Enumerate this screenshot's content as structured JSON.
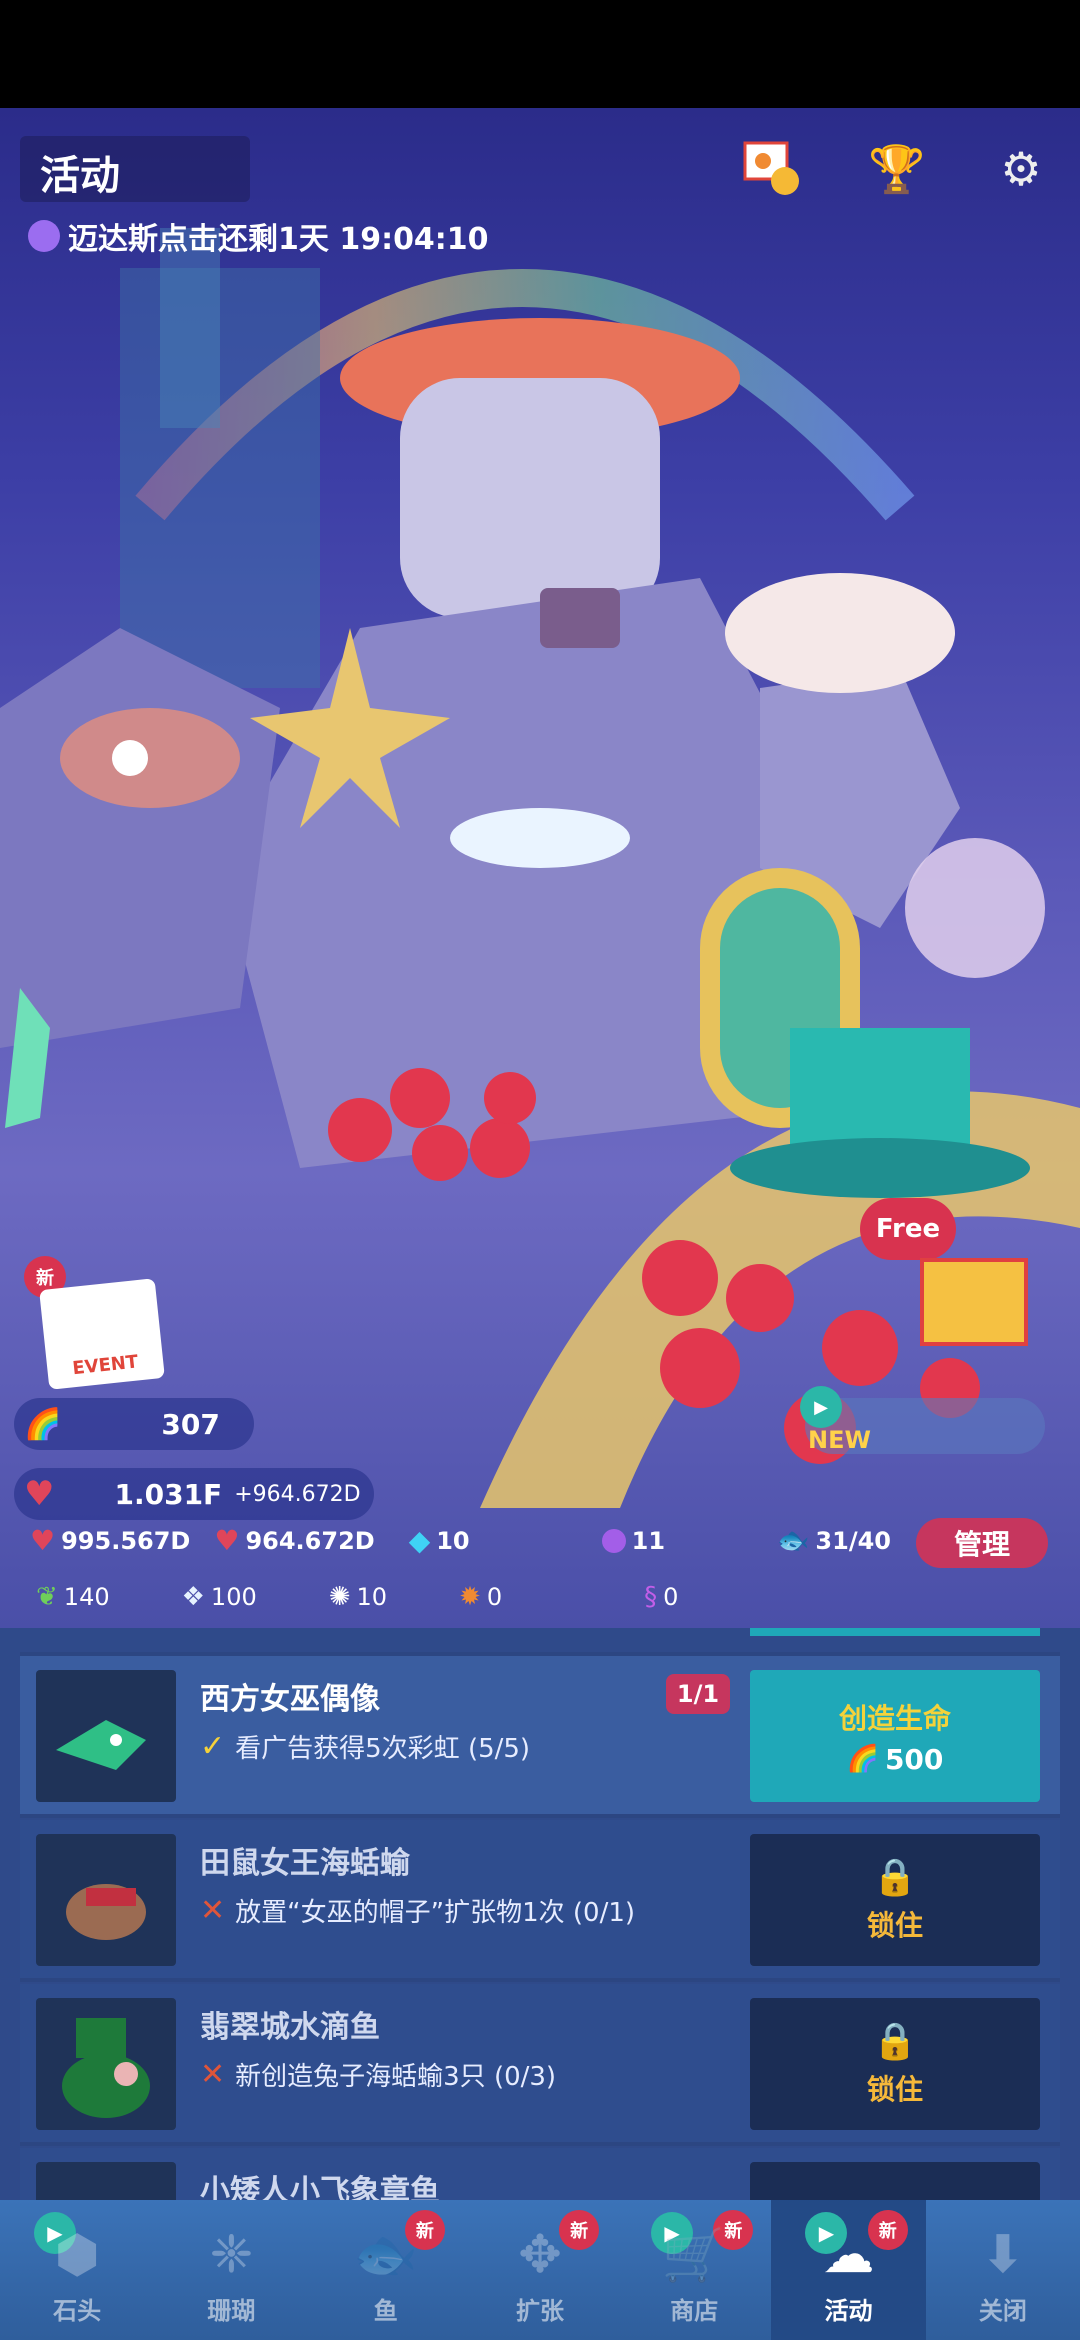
{
  "header": {
    "title": "活动",
    "countdown": "迈达斯点击还剩1天 19:04:10",
    "icons": [
      "photo-medal-icon",
      "trophy-icon",
      "gear-icon"
    ]
  },
  "scene": {
    "event_badge": "新",
    "event_label": "EVENT",
    "free_label": "Free",
    "new_label": "NEW"
  },
  "stats": {
    "rainbow_count": "307",
    "love_total": "1.031F",
    "love_rate": "+964.672D",
    "tap_value": "995.567D",
    "idle_value": "964.672D",
    "gems": "10",
    "pearls": "11",
    "fish_capacity": "31/40",
    "manage_label": "管理",
    "resources": [
      {
        "icon": "seaweed-icon",
        "value": "140"
      },
      {
        "icon": "crystal-icon",
        "value": "100"
      },
      {
        "icon": "shell-icon",
        "value": "10"
      },
      {
        "icon": "crab-icon",
        "value": "0"
      },
      {
        "icon": "seahorse-icon",
        "value": "0"
      }
    ]
  },
  "list": {
    "rows": [
      {
        "title": "西方女巫偶像",
        "count": "1/1",
        "status": "check",
        "requirement": "看广告获得5次彩虹 (5/5)",
        "action": "创造生命",
        "cost": "500"
      },
      {
        "title": "田鼠女王海蛞蝓",
        "status": "cross",
        "requirement": "放置“女巫的帽子”扩张物1次 (0/1)",
        "action": "锁住"
      },
      {
        "title": "翡翠城水滴鱼",
        "status": "cross",
        "requirement": "新创造兔子海蛞蝓3只 (0/3)",
        "action": "锁住"
      },
      {
        "title": "小矮人小飞象章鱼"
      }
    ]
  },
  "nav": {
    "new_badge": "新",
    "items": [
      {
        "label": "石头",
        "icon": "rock-icon"
      },
      {
        "label": "珊瑚",
        "icon": "coral-icon"
      },
      {
        "label": "鱼",
        "icon": "fish-icon"
      },
      {
        "label": "扩张",
        "icon": "expand-icon"
      },
      {
        "label": "商店",
        "icon": "cart-icon"
      },
      {
        "label": "活动",
        "icon": "event-icon"
      },
      {
        "label": "关闭",
        "icon": "close-down-icon"
      }
    ]
  },
  "colors": {
    "accent_pink": "#c6365e",
    "create_teal": "#1fa8b8",
    "lock_gold": "#f5b83a",
    "list_bg": "#3a5da0"
  }
}
